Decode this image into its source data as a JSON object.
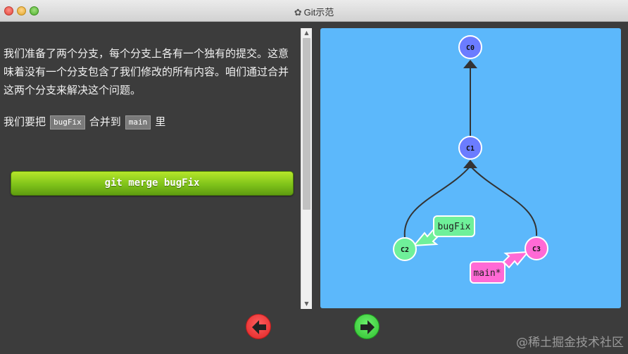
{
  "window": {
    "title": "Git示范",
    "gear_icon": "gear-icon"
  },
  "lesson": {
    "paragraph1": "我们准备了两个分支，每个分支上各有一个独有的提交。这意味着没有一个分支包含了我们修改的所有内容。咱们通过合并这两个分支来解决这个问题。",
    "paragraph2_prefix": "我们要把",
    "branch_from": "bugFix",
    "paragraph2_middle": "合并到",
    "branch_to": "main",
    "paragraph2_suffix": "里",
    "command": "git merge bugFix"
  },
  "graph": {
    "commits": [
      {
        "id": "C0",
        "color": "#6b7cff"
      },
      {
        "id": "C1",
        "color": "#6b7cff"
      },
      {
        "id": "C2",
        "color": "#6ff09a"
      },
      {
        "id": "C3",
        "color": "#ff6ad5"
      }
    ],
    "branches": [
      {
        "label": "bugFix",
        "target": "C2",
        "color": "#6ff09a"
      },
      {
        "label": "main*",
        "target": "C3",
        "color": "#ff6ad5"
      }
    ],
    "background": "#5cb8fb"
  },
  "nav": {
    "back_icon": "arrow-left-icon",
    "forward_icon": "arrow-right-icon"
  },
  "watermark": "@稀土掘金技术社区"
}
